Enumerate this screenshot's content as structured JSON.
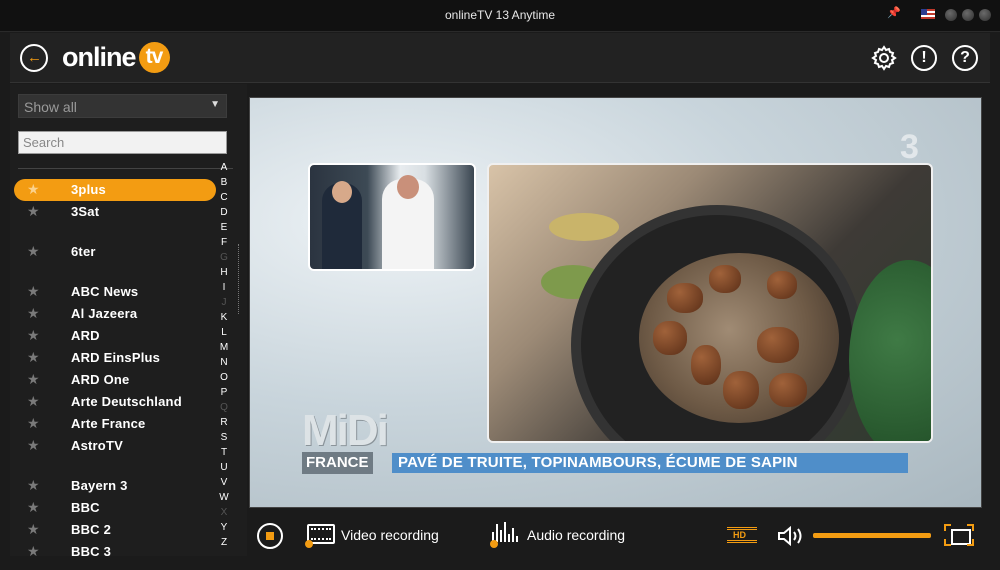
{
  "window": {
    "title": "onlineTV 13 Anytime"
  },
  "header": {
    "logo_word": "online",
    "logo_badge": "tv",
    "settings_icon": "gear-icon",
    "info_icon": "exclamation-circle-icon",
    "help_icon": "question-circle-icon",
    "help_glyph": "?",
    "info_glyph": "!"
  },
  "sidebar": {
    "filter": {
      "selected": "Show all"
    },
    "search": {
      "placeholder": "Search",
      "value": ""
    },
    "channels": [
      {
        "name": "3plus",
        "active": true
      },
      {
        "name": "3Sat",
        "active": false
      },
      {
        "name": "6ter",
        "active": false
      },
      {
        "name": "ABC News",
        "active": false
      },
      {
        "name": "Al Jazeera",
        "active": false
      },
      {
        "name": "ARD",
        "active": false
      },
      {
        "name": "ARD EinsPlus",
        "active": false
      },
      {
        "name": "ARD One",
        "active": false
      },
      {
        "name": "Arte Deutschland",
        "active": false
      },
      {
        "name": "Arte France",
        "active": false
      },
      {
        "name": "AstroTV",
        "active": false
      },
      {
        "name": "Bayern 3",
        "active": false
      },
      {
        "name": "BBC",
        "active": false
      },
      {
        "name": "BBC 2",
        "active": false
      },
      {
        "name": "BBC 3",
        "active": false
      }
    ],
    "alphabet": [
      "A",
      "B",
      "C",
      "D",
      "E",
      "F",
      "G",
      "H",
      "I",
      "J",
      "K",
      "L",
      "M",
      "N",
      "O",
      "P",
      "Q",
      "R",
      "S",
      "T",
      "U",
      "V",
      "W",
      "X",
      "Y",
      "Z"
    ],
    "alphabet_dimmed": [
      "G",
      "J",
      "Q",
      "X"
    ]
  },
  "video": {
    "channel_watermark": "3",
    "show_logo": "MiDi",
    "show_logo_tag": "FRANCE",
    "lower_third": "PAVÉ DE TRUITE, TOPINAMBOURS, ÉCUME DE SAPIN"
  },
  "controls": {
    "video_recording_label": "Video recording",
    "audio_recording_label": "Audio recording",
    "volume_level": 1.0
  },
  "colors": {
    "accent": "#f39c12",
    "background": "#1b1b1b",
    "lower_third": "#4f8ec9"
  }
}
